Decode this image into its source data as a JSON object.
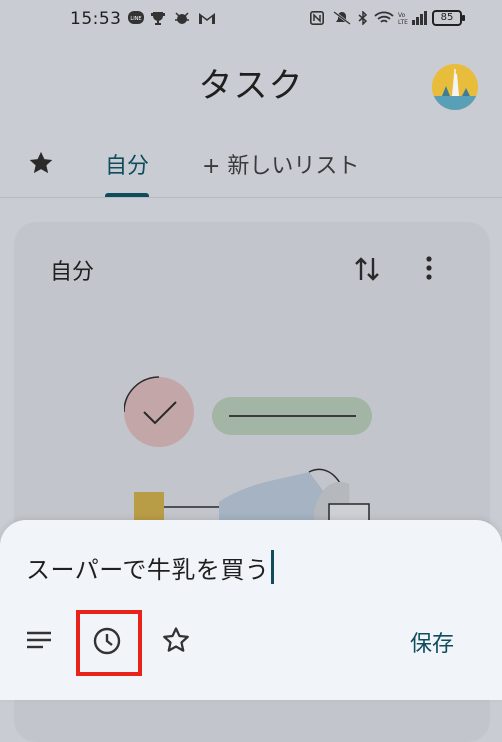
{
  "status_bar": {
    "time": "15:53",
    "battery": "85"
  },
  "header": {
    "title": "タスク"
  },
  "tabs": {
    "self": "自分",
    "new_list": "+ 新しいリスト"
  },
  "card": {
    "title": "自分"
  },
  "sheet": {
    "task_text": "スーパーで牛乳を買う",
    "save_label": "保存"
  },
  "colors": {
    "accent": "#0f4c5c",
    "highlight": "#e8231a",
    "sheet_bg": "#f1f5f9",
    "background": "#c9ccd2"
  }
}
